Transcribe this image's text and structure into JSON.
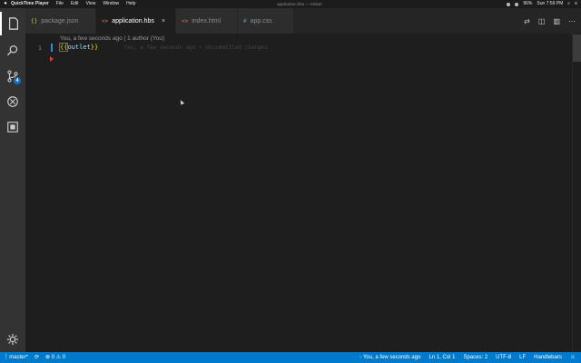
{
  "menubar": {
    "apple": "",
    "app_name": "QuickTime Player",
    "items": [
      "File",
      "Edit",
      "View",
      "Window",
      "Help"
    ],
    "center_title": "application.hbs — ember",
    "battery": "96%",
    "clock": "Sun 7:59 PM"
  },
  "activity_bar": {
    "scm_badge": "4"
  },
  "tabs": [
    {
      "icon": "{}",
      "label": "package.json",
      "active": false
    },
    {
      "icon": "<>",
      "label": "application.hbs",
      "active": true,
      "close": "×"
    },
    {
      "icon": "<>",
      "label": "index.html",
      "active": false
    },
    {
      "icon": "#",
      "label": "app.css",
      "active": false
    }
  ],
  "editor": {
    "codelens": "You, a few seconds ago | 1 author (You)",
    "line_number": "1",
    "code": {
      "open": "{{",
      "ident": "outlet",
      "close": "}}"
    },
    "inline_blame": "You, a few seconds ago • Uncommitted changes"
  },
  "statusbar": {
    "branch": "master*",
    "errors": "0",
    "warnings": "0",
    "blame": "You, a few seconds ago",
    "position": "Ln 1, Col 1",
    "spaces": "Spaces: 2",
    "encoding": "UTF-8",
    "eol": "LF",
    "language": "Handlebars",
    "feedback_icon": "smiley-icon"
  },
  "colors": {
    "statusbar": "#007acc",
    "activity_bar": "#333333",
    "editor_bg": "#1e1e1e",
    "badge": "#0e70c0"
  }
}
